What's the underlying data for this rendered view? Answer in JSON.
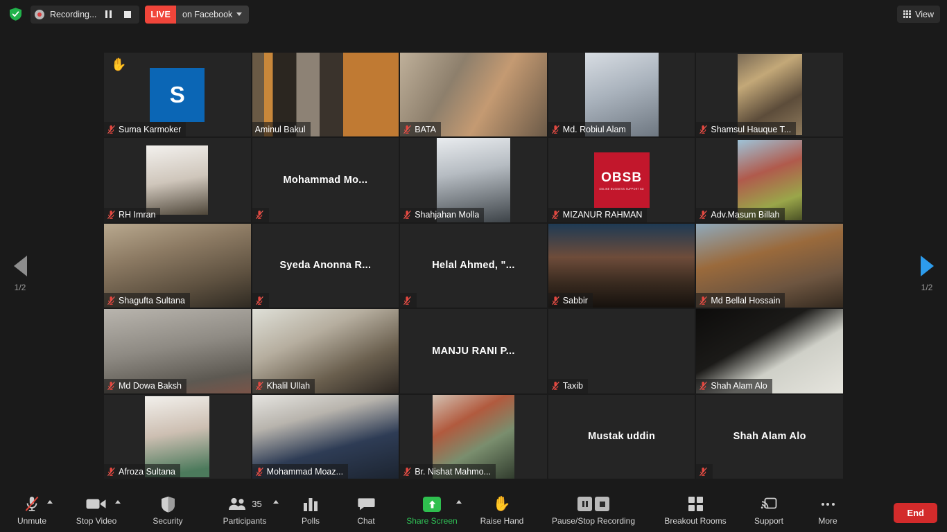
{
  "topbar": {
    "shield_icon": "shield-check-icon",
    "recording_label": "Recording...",
    "pause_icon": "pause-icon",
    "stop_icon": "stop-icon",
    "live_badge": "LIVE",
    "live_destination": "on Facebook",
    "caret_icon": "chevron-down-icon",
    "view_label": "View",
    "view_icon": "grid-icon"
  },
  "pagination": {
    "prev_icon": "triangle-left-icon",
    "next_icon": "triangle-right-icon",
    "left_page": "1/2",
    "right_page": "1/2"
  },
  "gallery": {
    "columns": 5,
    "rows": 5,
    "active_speaker": "Aminul Bakul",
    "active_border_color": "#e5e84a",
    "tiles": [
      {
        "name": "Suma Karmoker",
        "layout": "avatar",
        "avatar_letter": "S",
        "avatar_color": "#0b66b5",
        "muted": true,
        "hand_raised": true,
        "label_mode": "tag"
      },
      {
        "name": "Aminul Bakul",
        "layout": "video",
        "muted": false,
        "active": true,
        "label_mode": "tag"
      },
      {
        "name": "BATA",
        "layout": "video",
        "muted": true,
        "label_mode": "tag"
      },
      {
        "name": "Md. Robiul Alam",
        "layout": "video",
        "muted": true,
        "label_mode": "tag"
      },
      {
        "name": "Shamsul Hauque T...",
        "layout": "video",
        "muted": true,
        "label_mode": "tag"
      },
      {
        "name": "RH Imran",
        "layout": "photo",
        "muted": true,
        "label_mode": "tag"
      },
      {
        "name": "Mohammad  Mo...",
        "layout": "name",
        "muted": true,
        "label_mode": "center"
      },
      {
        "name": "Shahjahan Molla",
        "layout": "video",
        "muted": true,
        "label_mode": "tag"
      },
      {
        "name": "MIZANUR RAHMAN",
        "layout": "logo",
        "logo_text": "OBSB",
        "logo_subtext": "ONLINE BUSINESS SUPPORT BD",
        "logo_color": "#c2172c",
        "muted": true,
        "label_mode": "tag"
      },
      {
        "name": "Adv.Masum Billah",
        "layout": "video",
        "muted": true,
        "label_mode": "tag"
      },
      {
        "name": "Shagufta Sultana",
        "layout": "video",
        "muted": true,
        "label_mode": "tag"
      },
      {
        "name": "Syeda  Anonna  R...",
        "layout": "name",
        "muted": true,
        "label_mode": "center"
      },
      {
        "name": "Helal   Ahmed, \"...",
        "layout": "name",
        "muted": true,
        "label_mode": "center"
      },
      {
        "name": "Sabbir",
        "layout": "video",
        "muted": true,
        "label_mode": "tag"
      },
      {
        "name": "Md Bellal Hossain",
        "layout": "video",
        "muted": true,
        "label_mode": "tag"
      },
      {
        "name": "Md Dowa Baksh",
        "layout": "video",
        "muted": true,
        "label_mode": "tag"
      },
      {
        "name": "Khalil Ullah",
        "layout": "video",
        "muted": true,
        "label_mode": "tag"
      },
      {
        "name": "MANJU RANI P...",
        "layout": "name",
        "muted": false,
        "label_mode": "center"
      },
      {
        "name": "Taxib",
        "layout": "blank",
        "muted": true,
        "label_mode": "tag"
      },
      {
        "name": "Shah Alam Alo",
        "layout": "video",
        "muted": true,
        "label_mode": "tag"
      },
      {
        "name": "Afroza Sultana",
        "layout": "video",
        "muted": true,
        "label_mode": "tag"
      },
      {
        "name": "Mohammad Moaz...",
        "layout": "video",
        "muted": true,
        "label_mode": "tag"
      },
      {
        "name": "Br. Nishat Mahmo...",
        "layout": "video",
        "muted": true,
        "label_mode": "tag"
      },
      {
        "name": "Mustak uddin",
        "layout": "name",
        "muted": false,
        "label_mode": "center"
      },
      {
        "name": "Shah Alam Alo",
        "layout": "name",
        "muted": true,
        "label_mode": "center"
      }
    ]
  },
  "toolbar": {
    "items": [
      {
        "label": "Unmute",
        "icon": "microphone-muted-icon",
        "caret": true
      },
      {
        "label": "Stop Video",
        "icon": "video-camera-icon",
        "caret": true
      },
      {
        "label": "Security",
        "icon": "shield-icon",
        "caret": false
      },
      {
        "label": "Participants",
        "icon": "participants-icon",
        "count": "35",
        "caret": true
      },
      {
        "label": "Polls",
        "icon": "bar-chart-icon",
        "caret": false
      },
      {
        "label": "Chat",
        "icon": "chat-bubble-icon",
        "caret": false
      },
      {
        "label": "Share Screen",
        "icon": "share-screen-icon",
        "caret": true,
        "accent": "#30c357"
      },
      {
        "label": "Raise Hand",
        "icon": "raised-hand-icon",
        "caret": false
      },
      {
        "label": "Pause/Stop Recording",
        "icon": "pause-stop-recording-icon",
        "caret": false
      },
      {
        "label": "Breakout Rooms",
        "icon": "breakout-rooms-icon",
        "caret": false
      },
      {
        "label": "Support",
        "icon": "support-screen-icon",
        "caret": false
      },
      {
        "label": "More",
        "icon": "ellipsis-icon",
        "caret": false
      }
    ],
    "end_label": "End",
    "end_color": "#d32b2b"
  }
}
